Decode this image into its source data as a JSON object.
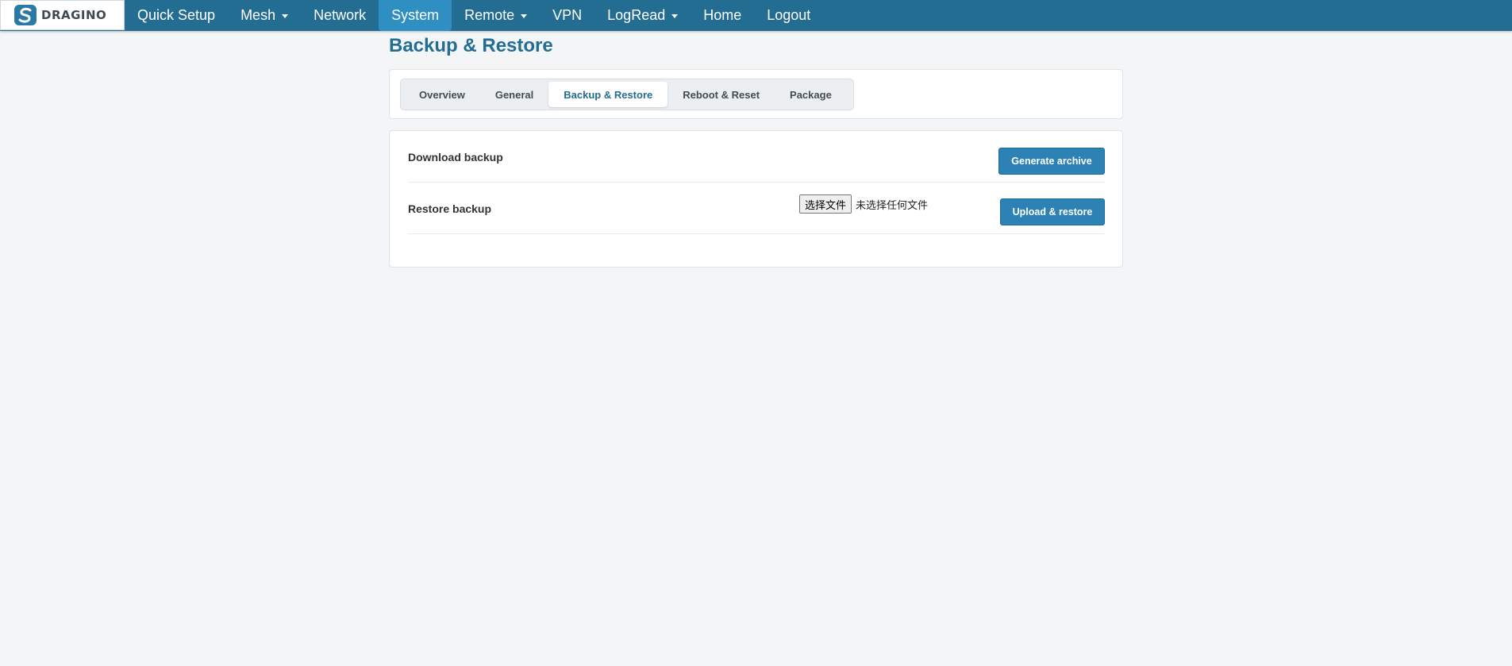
{
  "brand": {
    "logo_text": "DRAGINO"
  },
  "nav": {
    "items": [
      {
        "label": "Quick Setup",
        "dropdown": false,
        "active": false
      },
      {
        "label": "Mesh",
        "dropdown": true,
        "active": false
      },
      {
        "label": "Network",
        "dropdown": false,
        "active": false
      },
      {
        "label": "System",
        "dropdown": false,
        "active": true
      },
      {
        "label": "Remote",
        "dropdown": true,
        "active": false
      },
      {
        "label": "VPN",
        "dropdown": false,
        "active": false
      },
      {
        "label": "LogRead",
        "dropdown": true,
        "active": false
      },
      {
        "label": "Home",
        "dropdown": false,
        "active": false
      },
      {
        "label": "Logout",
        "dropdown": false,
        "active": false
      }
    ]
  },
  "page": {
    "title": "Backup & Restore"
  },
  "tabs": [
    {
      "label": "Overview",
      "active": false
    },
    {
      "label": "General",
      "active": false
    },
    {
      "label": "Backup & Restore",
      "active": true
    },
    {
      "label": "Reboot & Reset",
      "active": false
    },
    {
      "label": "Package",
      "active": false
    }
  ],
  "download": {
    "label": "Download backup",
    "button": "Generate archive"
  },
  "restore": {
    "label": "Restore backup",
    "file_button": "选择文件",
    "file_status": "未选择任何文件",
    "button": "Upload & restore"
  },
  "colors": {
    "navbar": "#236d93",
    "nav_active": "#2f8ec2",
    "button": "#2c82b4",
    "title": "#236d93",
    "background": "#f3f5f7"
  }
}
